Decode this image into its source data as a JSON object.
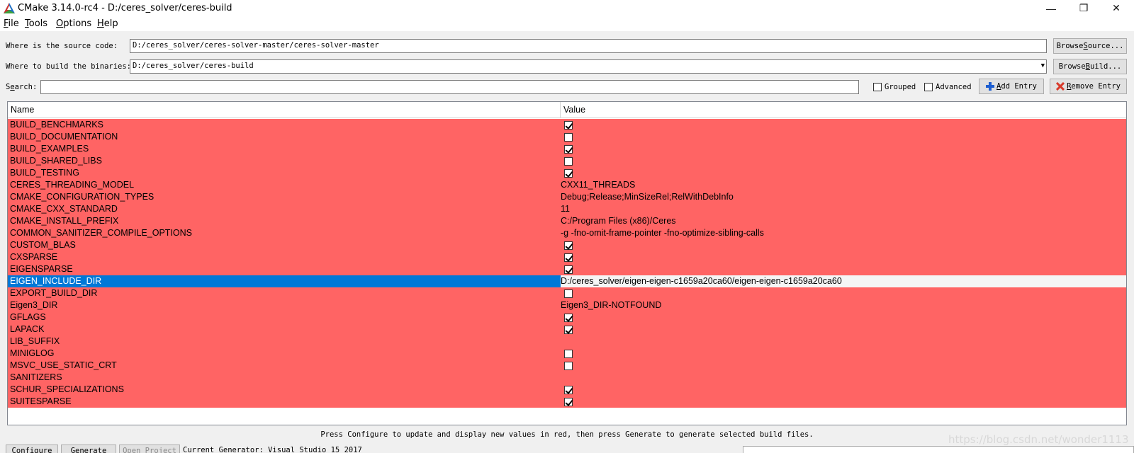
{
  "window": {
    "title": "CMake 3.14.0-rc4 - D:/ceres_solver/ceres-build",
    "minimize_icon": "minimize-icon",
    "maximize_icon": "restore-icon",
    "close_icon": "close-icon"
  },
  "menu": {
    "items": [
      {
        "acc": "F",
        "rest": "ile"
      },
      {
        "acc": "T",
        "rest": "ools"
      },
      {
        "acc": "O",
        "rest": "ptions"
      },
      {
        "acc": "H",
        "rest": "elp"
      }
    ]
  },
  "source": {
    "label": "Where is the source code:",
    "value": "D:/ceres_solver/ceres-solver-master/ceres-solver-master",
    "button_pre": "Browse ",
    "button_acc": "S",
    "button_post": "ource..."
  },
  "build": {
    "label": "Where to build the binaries:",
    "value": "D:/ceres_solver/ceres-build",
    "button_pre": "Browse ",
    "button_acc": "B",
    "button_post": "uild..."
  },
  "search": {
    "label_pre": "S",
    "label_acc": "e",
    "label_post": "arch:",
    "value": "",
    "grouped_label": "Grouped",
    "grouped_checked": false,
    "advanced_label": "Advanced",
    "advanced_checked": false,
    "add_entry_acc": "A",
    "add_entry_rest": "dd Entry",
    "add_entry_icon": "plus-icon",
    "remove_entry_acc": "R",
    "remove_entry_rest": "emove Entry",
    "remove_entry_icon": "remove-x-icon"
  },
  "table": {
    "headers": {
      "name": "Name",
      "value": "Value"
    },
    "rows": [
      {
        "name": "BUILD_BENCHMARKS",
        "type": "bool",
        "checked": true
      },
      {
        "name": "BUILD_DOCUMENTATION",
        "type": "bool",
        "checked": false
      },
      {
        "name": "BUILD_EXAMPLES",
        "type": "bool",
        "checked": true
      },
      {
        "name": "BUILD_SHARED_LIBS",
        "type": "bool",
        "checked": false
      },
      {
        "name": "BUILD_TESTING",
        "type": "bool",
        "checked": true
      },
      {
        "name": "CERES_THREADING_MODEL",
        "type": "text",
        "value": "CXX11_THREADS"
      },
      {
        "name": "CMAKE_CONFIGURATION_TYPES",
        "type": "text",
        "value": "Debug;Release;MinSizeRel;RelWithDebInfo"
      },
      {
        "name": "CMAKE_CXX_STANDARD",
        "type": "text",
        "value": "11"
      },
      {
        "name": "CMAKE_INSTALL_PREFIX",
        "type": "text",
        "value": "C:/Program Files (x86)/Ceres"
      },
      {
        "name": "COMMON_SANITIZER_COMPILE_OPTIONS",
        "type": "text",
        "value": "-g -fno-omit-frame-pointer -fno-optimize-sibling-calls"
      },
      {
        "name": "CUSTOM_BLAS",
        "type": "bool",
        "checked": true
      },
      {
        "name": "CXSPARSE",
        "type": "bool",
        "checked": true
      },
      {
        "name": "EIGENSPARSE",
        "type": "bool",
        "checked": true
      },
      {
        "name": "EIGEN_INCLUDE_DIR",
        "type": "text",
        "value": "D:/ceres_solver/eigen-eigen-c1659a20ca60/eigen-eigen-c1659a20ca60",
        "selected": true
      },
      {
        "name": "EXPORT_BUILD_DIR",
        "type": "bool",
        "checked": false
      },
      {
        "name": "Eigen3_DIR",
        "type": "text",
        "value": "Eigen3_DIR-NOTFOUND"
      },
      {
        "name": "GFLAGS",
        "type": "bool",
        "checked": true
      },
      {
        "name": "LAPACK",
        "type": "bool",
        "checked": true
      },
      {
        "name": "LIB_SUFFIX",
        "type": "text",
        "value": ""
      },
      {
        "name": "MINIGLOG",
        "type": "bool",
        "checked": false
      },
      {
        "name": "MSVC_USE_STATIC_CRT",
        "type": "bool",
        "checked": false
      },
      {
        "name": "SANITIZERS",
        "type": "text",
        "value": ""
      },
      {
        "name": "SCHUR_SPECIALIZATIONS",
        "type": "bool",
        "checked": true
      },
      {
        "name": "SUITESPARSE",
        "type": "bool",
        "checked": true
      }
    ]
  },
  "status_message": "Press Configure to update and display new values in red, then press Generate to generate selected build files.",
  "bottom": {
    "configure_label": "Configure",
    "generate_label": "Generate",
    "open_project_label": "Open Project",
    "generator_label": "Current Generator: Visual Studio 15 2017"
  },
  "watermark": "https://blog.csdn.net/wonder1113",
  "colors": {
    "changed_row": "#ff6464",
    "selected_row": "#0078d7"
  }
}
